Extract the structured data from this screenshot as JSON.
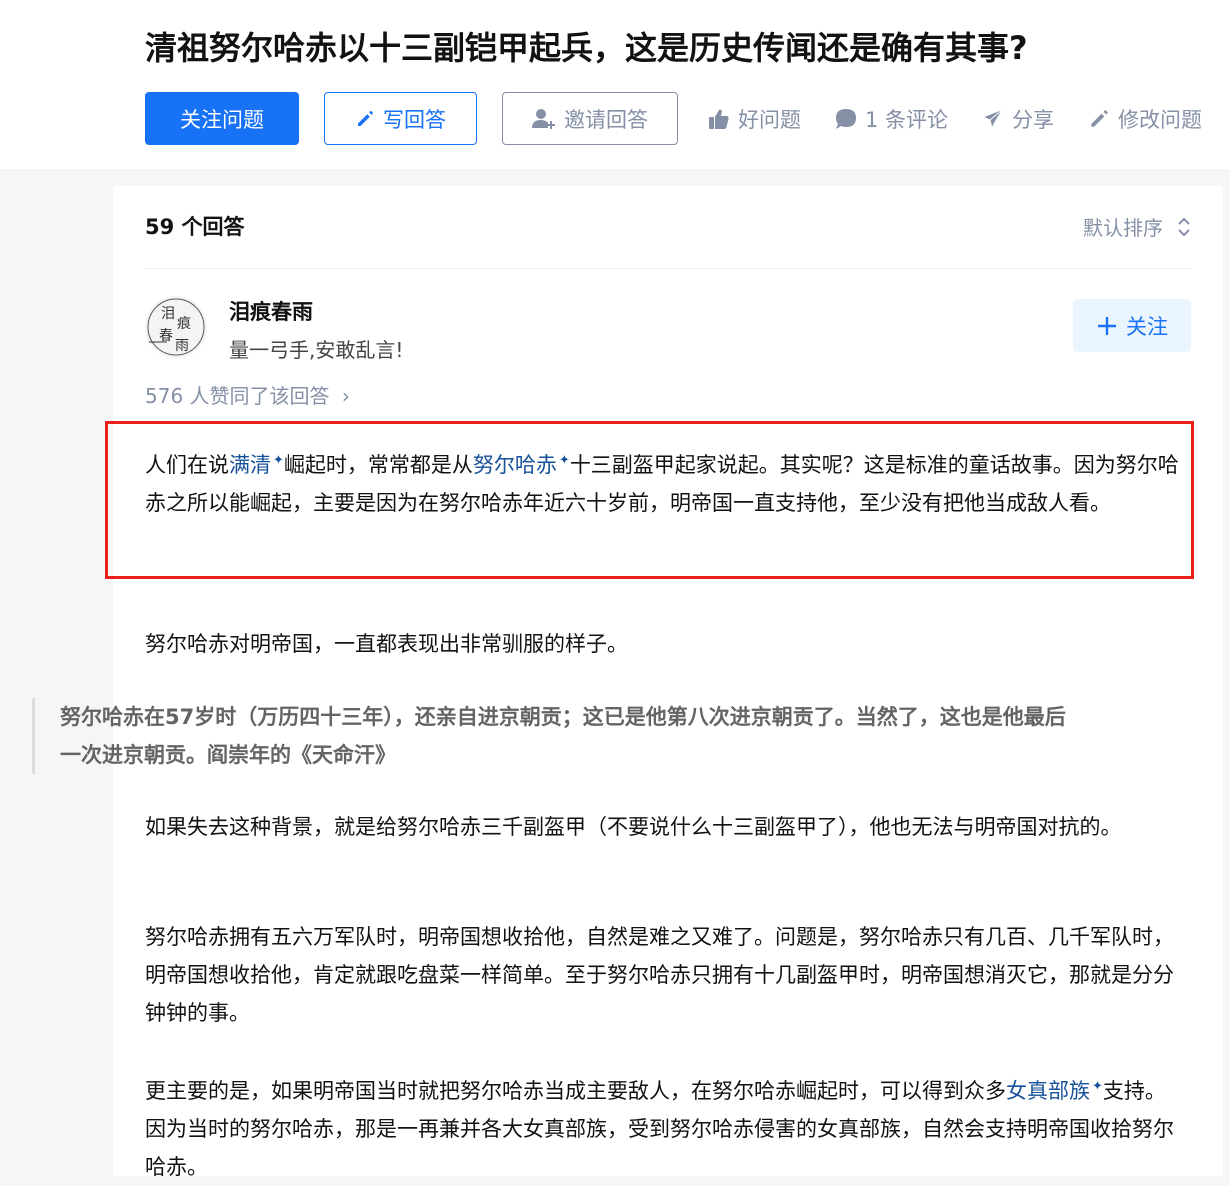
{
  "question": {
    "title": "清祖努尔哈赤以十三副铠甲起兵，这是历史传闻还是确有其事?",
    "actions": {
      "follow": "关注问题",
      "write": "写回答",
      "invite": "邀请回答",
      "good_question": "好问题",
      "comments": "1 条评论",
      "share": "分享",
      "edit": "修改问题"
    }
  },
  "answers": {
    "count_label": "59 个回答",
    "sort_label": "默认排序"
  },
  "author": {
    "name": "泪痕春雨",
    "bio": "量一弓手,安敢乱言!",
    "follow_label": "关注",
    "avatar_text": [
      "泪",
      "痕",
      "春",
      "雨"
    ]
  },
  "votes_label": "576 人赞同了该回答",
  "content": {
    "p1": {
      "a": "人们在说",
      "link1": "满清",
      "b": "崛起时，常常都是从",
      "link2": "努尔哈赤",
      "c": "十三副盔甲起家说起。其实呢？这是标准的童话故事。因为努尔哈赤之所以能崛起，主要是因为在努尔哈赤年近六十岁前，明帝国一直支持他，至少没有把他当成敌人看。"
    },
    "p2": "努尔哈赤对明帝国，一直都表现出非常驯服的样子。",
    "quote": "努尔哈赤在57岁时（万历四十三年），还亲自进京朝贡；这已是他第八次进京朝贡了。当然了，这也是他最后一次进京朝贡。阎崇年的《天命汗》",
    "p3": "如果失去这种背景，就是给努尔哈赤三千副盔甲（不要说什么十三副盔甲了），他也无法与明帝国对抗的。",
    "p4": "努尔哈赤拥有五六万军队时，明帝国想收拾他，自然是难之又难了。问题是，努尔哈赤只有几百、几千军队时，明帝国想收拾他，肯定就跟吃盘菜一样简单。至于努尔哈赤只拥有十几副盔甲时，明帝国想消灭它，那就是分分钟钟的事。",
    "p5": {
      "a": "更主要的是，如果明帝国当时就把努尔哈赤当成主要敌人，在努尔哈赤崛起时，可以得到众多",
      "link": "女真部族",
      "b": "支持。因为当时的努尔哈赤，那是一再兼并各大女真部族，受到努尔哈赤侵害的女真部族，自然会支持明帝国收拾努尔哈赤。"
    }
  },
  "colors": {
    "primary": "#1772f6",
    "muted": "#8590a6",
    "link": "#175199",
    "highlight_border": "#e8211c"
  }
}
